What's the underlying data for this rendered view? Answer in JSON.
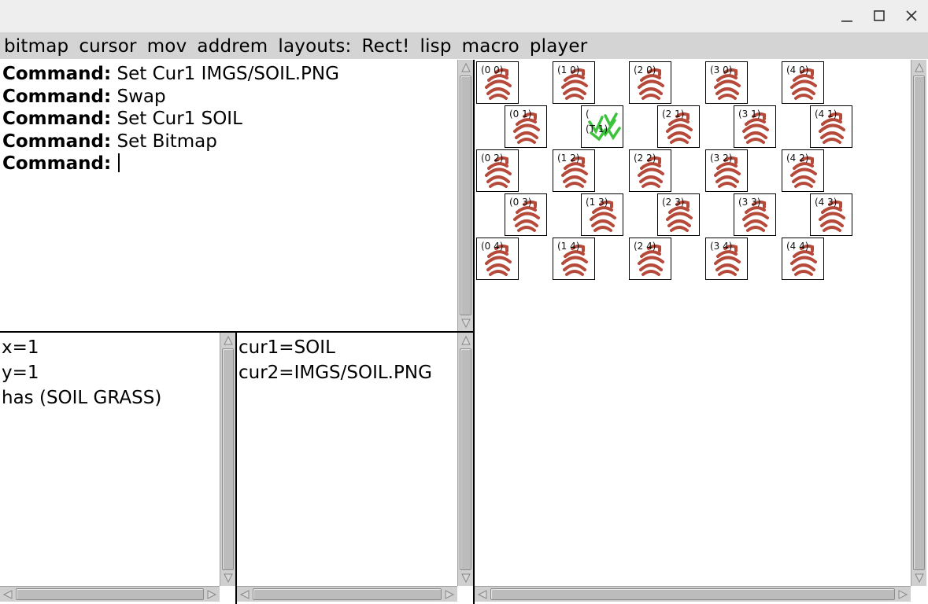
{
  "window": {
    "controls": [
      "minimize-icon",
      "maximize-icon",
      "close-icon"
    ]
  },
  "menubar": {
    "items": [
      "bitmap",
      "cursor",
      "mov",
      "addrem",
      "layouts:",
      "Rect!",
      "lisp",
      "macro",
      "player"
    ]
  },
  "command_pane": {
    "prefix": "Command:",
    "lines": [
      "Set Cur1 IMGS/SOIL.PNG",
      "Swap",
      "Set Cur1 SOIL",
      "Set Bitmap",
      ""
    ]
  },
  "position_pane": {
    "lines": [
      "x=1",
      "y=1",
      "has (SOIL GRASS)"
    ]
  },
  "cursor_pane": {
    "lines": [
      "cur1=SOIL",
      "cur2=IMGS/SOIL.PNG"
    ]
  },
  "grid": {
    "soil_color": "#b5493a",
    "grass_color": "#3cc23c",
    "tiles": [
      {
        "label": "(0 0)",
        "type": "soil"
      },
      {
        "label": "(1 0)",
        "type": "soil"
      },
      {
        "label": "(2 0)",
        "type": "soil"
      },
      {
        "label": "(3 0)",
        "type": "soil"
      },
      {
        "label": "(4 0)",
        "type": "soil"
      },
      {
        "label": "(0 1)",
        "type": "soil"
      },
      {
        "label": "(",
        "sub": "(T 1)",
        "type": "grass"
      },
      {
        "label": "(2 1)",
        "type": "soil"
      },
      {
        "label": "(3 1)",
        "type": "soil"
      },
      {
        "label": "(4 1)",
        "type": "soil"
      },
      {
        "label": "(0 2)",
        "type": "soil"
      },
      {
        "label": "(1 2)",
        "type": "soil"
      },
      {
        "label": "(2 2)",
        "type": "soil"
      },
      {
        "label": "(3 2)",
        "type": "soil"
      },
      {
        "label": "(4 2)",
        "type": "soil"
      },
      {
        "label": "(0 3)",
        "type": "soil"
      },
      {
        "label": "(1 3)",
        "type": "soil"
      },
      {
        "label": "(2 3)",
        "type": "soil"
      },
      {
        "label": "(3 3)",
        "type": "soil"
      },
      {
        "label": "(4 3)",
        "type": "soil"
      },
      {
        "label": "(0 4)",
        "type": "soil"
      },
      {
        "label": "(1 4)",
        "type": "soil"
      },
      {
        "label": "(2 4)",
        "type": "soil"
      },
      {
        "label": "(3 4)",
        "type": "soil"
      },
      {
        "label": "(4 4)",
        "type": "soil"
      }
    ]
  }
}
